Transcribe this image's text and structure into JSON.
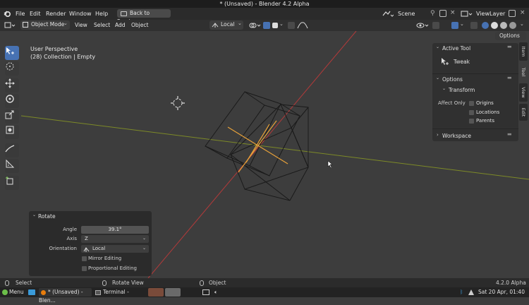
{
  "window": {
    "title": "* (Unsaved) - Blender 4.2 Alpha"
  },
  "menu": {
    "file": "File",
    "edit": "Edit",
    "render": "Render",
    "window": "Window",
    "help": "Help",
    "back_to_previous": "Back to Previous"
  },
  "workspace": {
    "scene": "Scene",
    "view_layer": "ViewLayer"
  },
  "header": {
    "mode": "Object Mode",
    "view": "View",
    "select": "Select",
    "add": "Add",
    "object": "Object",
    "orientation": "Local",
    "options": "Options"
  },
  "viewport": {
    "perspective": "User Perspective",
    "collection": "(28) Collection | Empty"
  },
  "n_panel": {
    "active_tool_header": "Active Tool",
    "active_tool": "Tweak",
    "options_header": "Options",
    "transform_header": "Transform",
    "affect_only": "Affect Only",
    "origins": "Origins",
    "locations": "Locations",
    "parents": "Parents",
    "workspace_header": "Workspace"
  },
  "side_tabs": {
    "item": "Item",
    "tool": "Tool",
    "view": "View",
    "edit": "Edit"
  },
  "redo_panel": {
    "title": "Rotate",
    "angle_label": "Angle",
    "angle_value": "39.1°",
    "axis_label": "Axis",
    "axis_value": "Z",
    "orientation_label": "Orientation",
    "orientation_value": "Local",
    "mirror_editing": "Mirror Editing",
    "proportional_editing": "Proportional Editing"
  },
  "status": {
    "select": "Select",
    "rotate_view": "Rotate View",
    "object": "Object",
    "version": "4.2.0 Alpha"
  },
  "taskbar": {
    "menu": "Menu",
    "blender_task": "* (Unsaved) - Blen...",
    "terminal_task": "Terminal -",
    "clock": "Sat 20 Apr, 01:40"
  },
  "colors": {
    "accent": "#4772b3",
    "x_axis": "#b33a3a",
    "y_axis": "#8a9a2a",
    "selection": "#e8a23a"
  }
}
